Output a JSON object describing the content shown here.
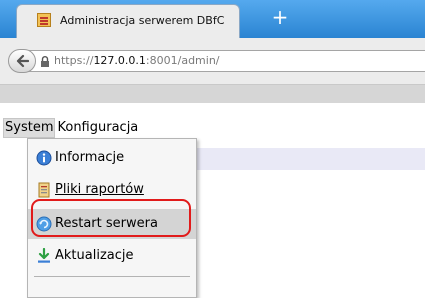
{
  "browser": {
    "tab_title": "Administracja serwerem DBfC",
    "new_tab_label": "+",
    "url_prefix": "https://",
    "url_host": "127.0.0.1",
    "url_suffix": ":8001/admin/"
  },
  "menubar": {
    "items": [
      {
        "label": "System"
      },
      {
        "label": "Konfiguracja"
      }
    ]
  },
  "dropdown": {
    "items": [
      {
        "label": "Informacje",
        "icon": "info-icon"
      },
      {
        "label": "Pliki raportów",
        "icon": "report-file-icon"
      },
      {
        "label": "Restart serwera",
        "icon": "restart-icon",
        "highlighted": true
      },
      {
        "label": "Aktualizacje",
        "icon": "update-download-icon"
      }
    ]
  },
  "colors": {
    "tabbar": "#2f8cd9",
    "highlight": "#d4d4d4",
    "annotation": "#e11b1b",
    "content_bar": "#e9e9f6"
  }
}
